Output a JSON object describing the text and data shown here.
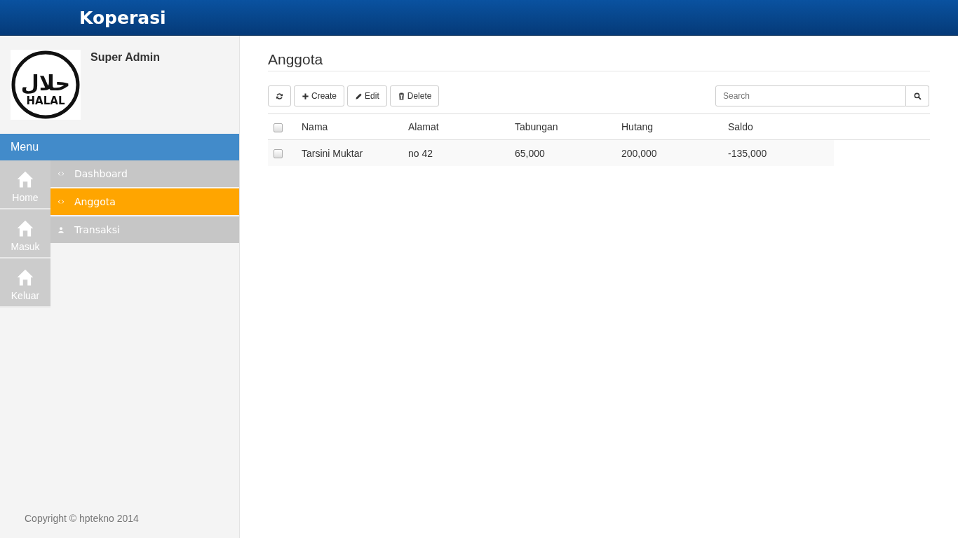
{
  "header": {
    "title": "Koperasi"
  },
  "profile": {
    "logo_texts": [
      "حلال",
      "HALAL"
    ],
    "name": "Super Admin"
  },
  "menu": {
    "title": "Menu",
    "tiles": [
      {
        "label": "Home"
      },
      {
        "label": "Masuk"
      },
      {
        "label": "Keluar"
      }
    ],
    "items": [
      {
        "label": "Dashboard",
        "kind": "code",
        "selected": false
      },
      {
        "label": "Anggota",
        "kind": "code",
        "selected": true
      },
      {
        "label": "Transaksi",
        "kind": "user",
        "selected": false
      }
    ]
  },
  "footer": {
    "copyright": "Copyright © hptekno 2014"
  },
  "page": {
    "title": "Anggota",
    "toolbar": [
      {
        "kind": "refresh"
      },
      {
        "kind": "plus",
        "label": "Create"
      },
      {
        "kind": "pencil",
        "label": "Edit"
      },
      {
        "kind": "trash",
        "label": "Delete"
      }
    ],
    "search": {
      "placeholder": "Search"
    },
    "table": {
      "header_checked": false,
      "columns": [
        "Nama",
        "Alamat",
        "Tabungan",
        "Hutang",
        "Saldo"
      ],
      "rows": [
        {
          "checked": false,
          "cells": [
            "Tarsini Muktar",
            "no 42",
            "65,000",
            "200,000",
            "-135,000"
          ]
        }
      ]
    }
  }
}
